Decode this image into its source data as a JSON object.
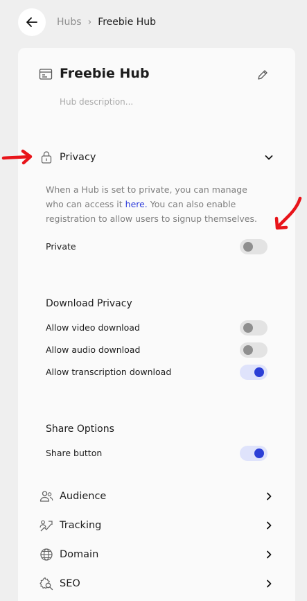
{
  "breadcrumb": {
    "parent": "Hubs",
    "separator": "›",
    "current": "Freebie Hub"
  },
  "hub": {
    "title": "Freebie Hub",
    "description_placeholder": "Hub description..."
  },
  "privacy": {
    "label": "Privacy",
    "desc_before": "When a Hub is set to private, you can manage who can access it ",
    "desc_link": "here.",
    "desc_after": " You can also enable registration to allow users to signup themselves.",
    "private_label": "Private",
    "private_on": false
  },
  "download_privacy": {
    "title": "Download Privacy",
    "items": [
      {
        "label": "Allow video download",
        "on": false
      },
      {
        "label": "Allow audio download",
        "on": false
      },
      {
        "label": "Allow transcription download",
        "on": true
      }
    ]
  },
  "share_options": {
    "title": "Share Options",
    "share_button_label": "Share button",
    "share_button_on": true
  },
  "nav_sections": [
    {
      "label": "Audience",
      "icon": "users-icon"
    },
    {
      "label": "Tracking",
      "icon": "tracking-icon"
    },
    {
      "label": "Domain",
      "icon": "globe-icon"
    },
    {
      "label": "SEO",
      "icon": "seo-gear-icon"
    }
  ],
  "colors": {
    "accent": "#2b3fd6",
    "link": "#2f3ddb",
    "annotation": "#e8141a"
  }
}
